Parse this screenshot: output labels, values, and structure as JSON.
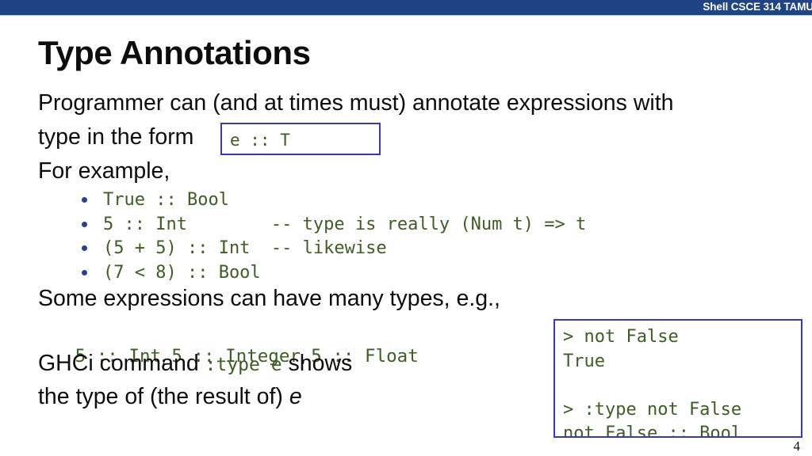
{
  "header": {
    "title": "Shell CSCE 314 TAMU"
  },
  "slide": {
    "title": "Type Annotations",
    "page_number": "4",
    "body": {
      "line1": "Programmer can (and at times must) annotate expressions with",
      "line2_prefix": "type in the form",
      "form_box_code": "e :: T",
      "line3": "For example,",
      "some_expressions": "Some expressions can have many types, e.g.,",
      "ghci_prefix": "GHCi command",
      "ghci_command": ":type e",
      "ghci_suffix": "shows",
      "last_line_prefix": "the type of (the result of)",
      "last_line_italic": "e"
    },
    "bullets": [
      "True :: Bool",
      "5 :: Int        -- type is really (Num t) => t",
      "(5 + 5) :: Int  -- likewise",
      "(7 < 8) :: Bool"
    ],
    "multi_types": {
      "part1": "5 :: Int",
      "sep1": ", ",
      "part2": "5 :: Integer",
      "sep2": ", ",
      "part3": "5 :: Float"
    },
    "console": {
      "lines": [
        "> not False",
        "True",
        "",
        "> :type not False",
        "not False :: Bool"
      ],
      "text": "> not False\nTrue\n\n> :type not False\nnot False :: Bool"
    }
  },
  "colors": {
    "header_bg": "#1f4486",
    "code_green": "#3f5d23",
    "box_border": "#3a35c9",
    "bullet_dot": "#2a3f8f",
    "body_text": "#0d0d0d"
  }
}
